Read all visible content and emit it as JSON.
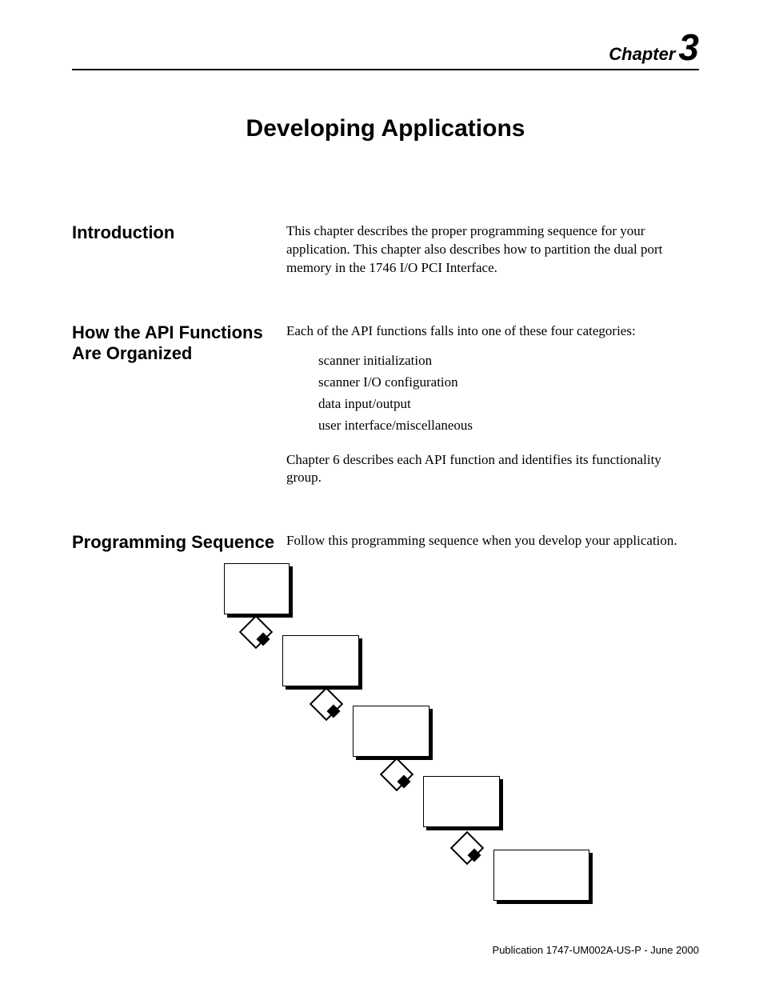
{
  "chapter": {
    "label": "Chapter",
    "number": "3"
  },
  "title": "Developing Applications",
  "sections": {
    "intro": {
      "heading": "Introduction",
      "body": "This chapter describes the proper programming sequence for your application. This chapter also describes how to partition the dual port memory in the 1746 I/O PCI Interface."
    },
    "api": {
      "heading": "How the API Functions Are Organized",
      "lead": "Each of the API functions falls into one of these four categories:",
      "bullets": [
        "scanner initialization",
        "scanner I/O configuration",
        "data input/output",
        "user interface/miscellaneous"
      ],
      "tail": "Chapter 6 describes each API function and identifies its functionality group."
    },
    "seq": {
      "heading": "Programming Sequence",
      "body": "Follow this programming sequence when you develop your application."
    }
  },
  "footer": "Publication 1747-UM002A-US-P - June 2000"
}
